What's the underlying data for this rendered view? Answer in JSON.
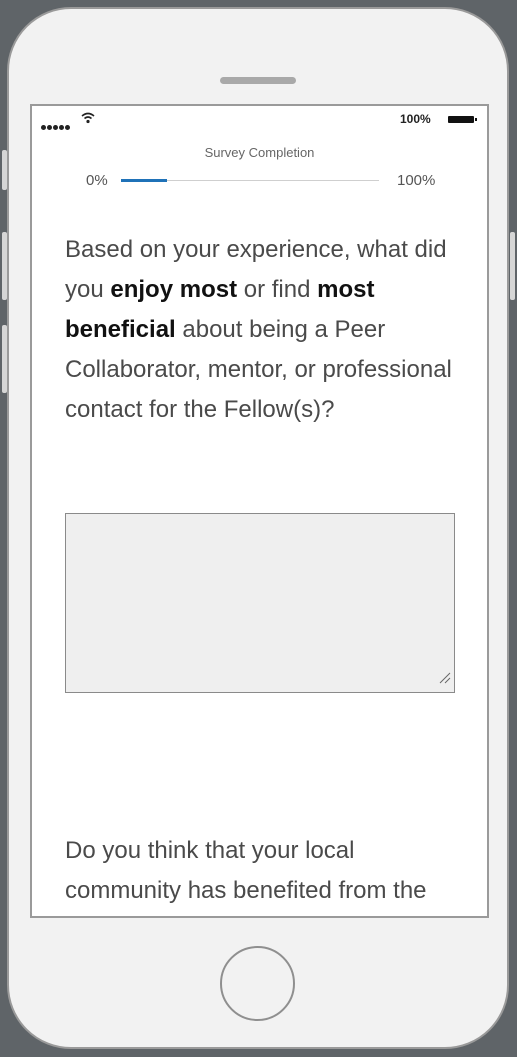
{
  "status": {
    "battery_text": "100%"
  },
  "progress": {
    "label": "Survey Completion",
    "min_label": "0%",
    "max_label": "100%",
    "value": 0.18,
    "color": "#1f72b8"
  },
  "question1": {
    "part1": "Based on your experience, what did you ",
    "bold1": "enjoy most",
    "part2": " or find ",
    "bold2": "most beneficial",
    "part3": " about being a Peer Collaborator, mentor, or professional contact for the Fellow(s)?"
  },
  "answer1": {
    "value": "",
    "placeholder": ""
  },
  "question2": {
    "text": "Do you think that your local community has benefited from the Mandela"
  },
  "icons": {
    "wifi": "wifi-icon",
    "battery": "battery-icon",
    "signal": "signal-icon",
    "home": "home-button-icon",
    "resize": "resize-grip-icon"
  }
}
